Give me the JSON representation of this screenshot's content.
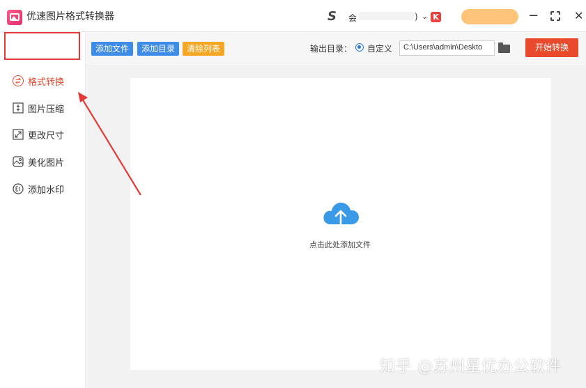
{
  "app": {
    "title": "优速图片格式转换器"
  },
  "account": {
    "label": "会",
    "suffix": ")",
    "badge": "K"
  },
  "sidebar": {
    "items": [
      {
        "label": "格式转换",
        "icon": "convert-icon",
        "active": true
      },
      {
        "label": "图片压缩",
        "icon": "compress-icon",
        "active": false
      },
      {
        "label": "更改尺寸",
        "icon": "resize-icon",
        "active": false
      },
      {
        "label": "美化图片",
        "icon": "beautify-icon",
        "active": false
      },
      {
        "label": "添加水印",
        "icon": "watermark-icon",
        "active": false
      }
    ]
  },
  "toolbar": {
    "add_file": "添加文件",
    "add_dir": "添加目录",
    "clear_list": "清除列表",
    "output_label": "输出目录：",
    "custom_label": "自定义",
    "output_path": "C:\\Users\\admin\\Deskto",
    "start": "开始转换"
  },
  "main": {
    "drop_hint": "点击此处添加文件"
  },
  "watermark": "知乎 @苏州星优办公软件",
  "colors": {
    "accent": "#e84a2b",
    "blue": "#3d8ce8",
    "orange": "#f5a623",
    "annotation": "#e53935"
  }
}
